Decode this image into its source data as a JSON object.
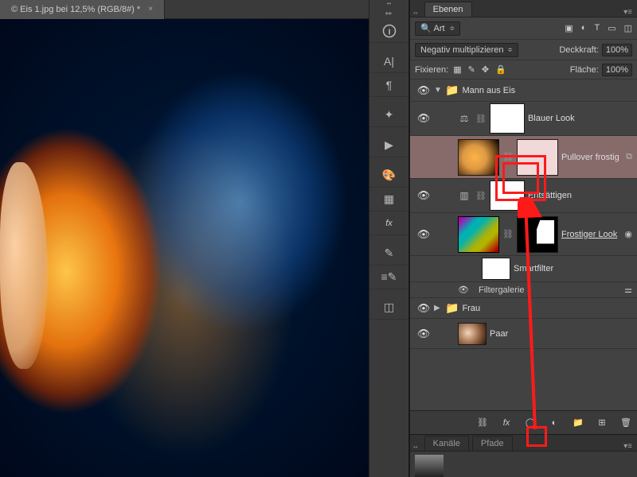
{
  "document": {
    "tab_title": "© Eis 1.jpg bei 12,5% (RGB/8#) *"
  },
  "panel": {
    "layers_tab": "Ebenen",
    "channels_tab": "Kanäle",
    "paths_tab": "Pfade",
    "filter_kind": "Art",
    "blend_mode": "Negativ multiplizieren",
    "opacity_label": "Deckkraft:",
    "opacity_value": "100%",
    "lock_label": "Fixieren:",
    "fill_label": "Fläche:",
    "fill_value": "100%"
  },
  "layers": {
    "group1": "Mann aus Eis",
    "l1": "Blauer Look",
    "l2": "Pullover frostig",
    "l3": "Entsättigen",
    "l4": "Frostiger Look",
    "smartfilter": "Smartfilter",
    "filtergalerie": "Filtergalerie",
    "group2": "Frau",
    "l5": "Paar"
  }
}
